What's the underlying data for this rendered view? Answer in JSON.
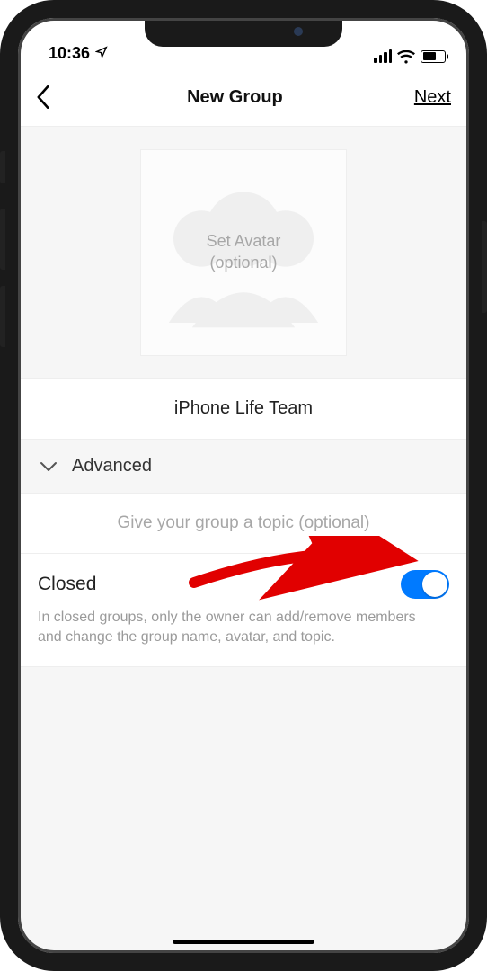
{
  "status": {
    "time": "10:36"
  },
  "nav": {
    "title": "New Group",
    "next": "Next"
  },
  "avatar": {
    "line1": "Set Avatar",
    "line2": "(optional)"
  },
  "group": {
    "name": "iPhone Life Team"
  },
  "advanced": {
    "label": "Advanced"
  },
  "topic": {
    "placeholder": "Give your group a topic (optional)"
  },
  "closed": {
    "title": "Closed",
    "description": "In closed groups, only the owner can add/remove members and change the group name, avatar, and topic.",
    "toggle_on": true
  }
}
